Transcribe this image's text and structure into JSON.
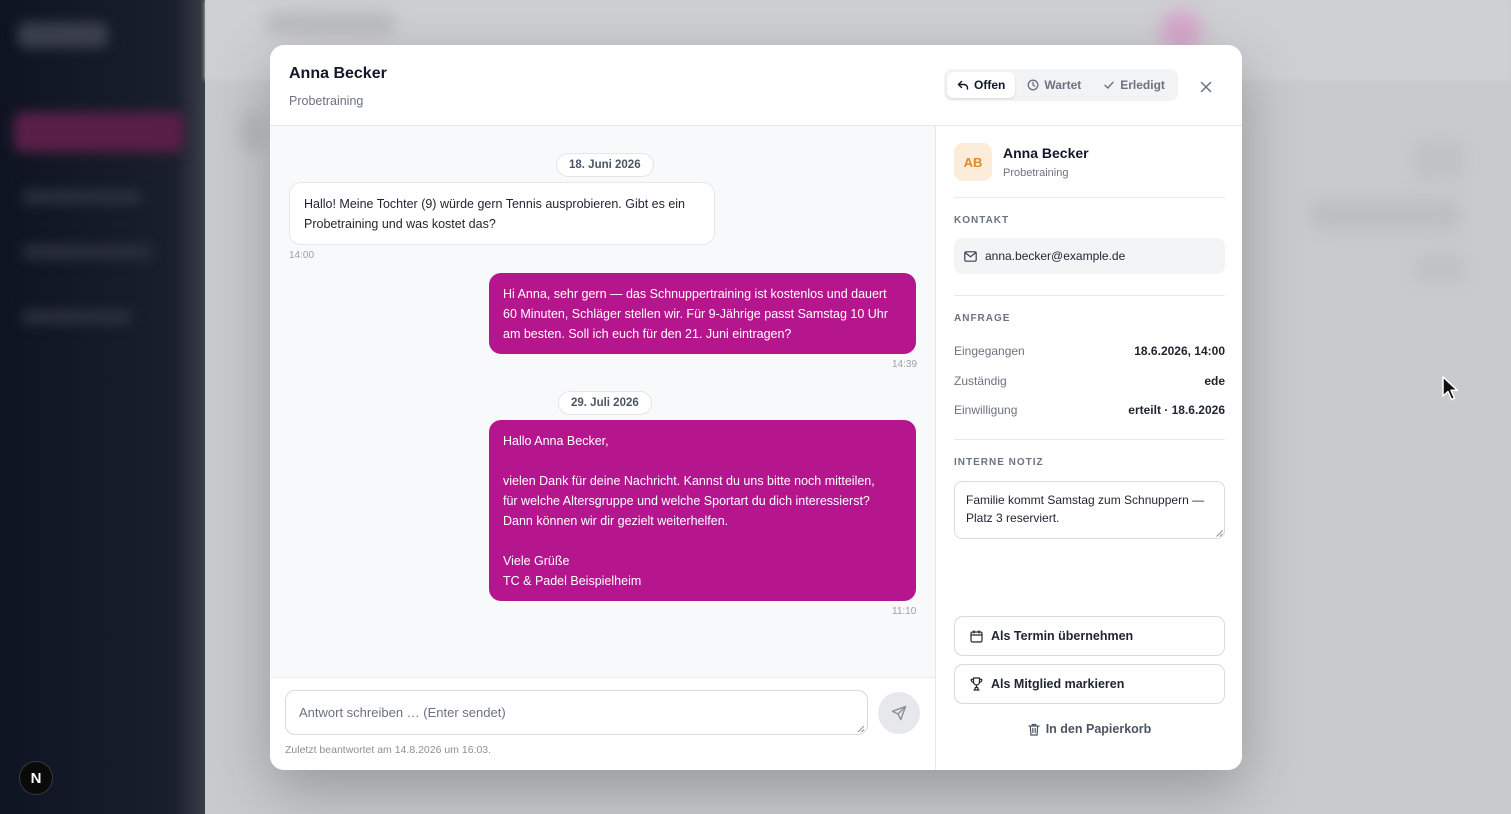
{
  "header": {
    "name": "Anna Becker",
    "subtitle": "Probetraining",
    "statuses": [
      {
        "label": "Offen",
        "icon": "reply-icon",
        "active": true
      },
      {
        "label": "Wartet",
        "icon": "clock-icon",
        "active": false
      },
      {
        "label": "Erledigt",
        "icon": "check-icon",
        "active": false
      }
    ]
  },
  "chat": {
    "dates": [
      "18. Juni 2026",
      "29. Juli 2026"
    ],
    "messages": [
      {
        "direction": "in",
        "text": "Hallo! Meine Tochter (9) würde gern Tennis ausprobieren. Gibt es ein\nProbetraining und was kostet das?",
        "time": "14:00"
      },
      {
        "direction": "out",
        "text": "Hi Anna, sehr gern — das Schnuppertraining ist kostenlos und dauert\n60 Minuten, Schläger stellen wir. Für 9-Jährige passt Samstag 10 Uhr\nam besten. Soll ich euch für den 21. Juni eintragen?",
        "time": "14:39"
      },
      {
        "direction": "out",
        "text": "Hallo Anna Becker,\n\nvielen Dank für deine Nachricht. Kannst du uns bitte noch mitteilen,\nfür welche Altersgruppe und welche Sportart du dich interessierst?\nDann können wir dir gezielt weiterhelfen.\n\nViele Grüße\nTC & Padel Beispielheim",
        "time": "11:10"
      }
    ]
  },
  "composer": {
    "placeholder": "Antwort schreiben … (Enter sendet)",
    "last_reply": "Zuletzt beantwortet am 14.8.2026 um 16:03."
  },
  "panel": {
    "avatar_initials": "AB",
    "name": "Anna Becker",
    "subtitle": "Probetraining",
    "contact_label": "KONTAKT",
    "email": "anna.becker@example.de",
    "request_label": "ANFRAGE",
    "details": [
      {
        "key": "Eingegangen",
        "value": "18.6.2026, 14:00"
      },
      {
        "key": "Zuständig",
        "value": "ede"
      },
      {
        "key": "Einwilligung",
        "value": "erteilt · 18.6.2026"
      }
    ],
    "note_label": "INTERNE NOTIZ",
    "note": "Familie kommt Samstag zum Schnuppern —\nPlatz 3 reserviert.",
    "actions": {
      "appointment": "Als Termin übernehmen",
      "member": "Als Mitglied markieren",
      "trash": "In den Papierkorb"
    }
  },
  "colors": {
    "accent": "#b5168e",
    "avatar_bg": "#fdecd9",
    "avatar_text": "#e0892e"
  },
  "framework_badge": "N"
}
